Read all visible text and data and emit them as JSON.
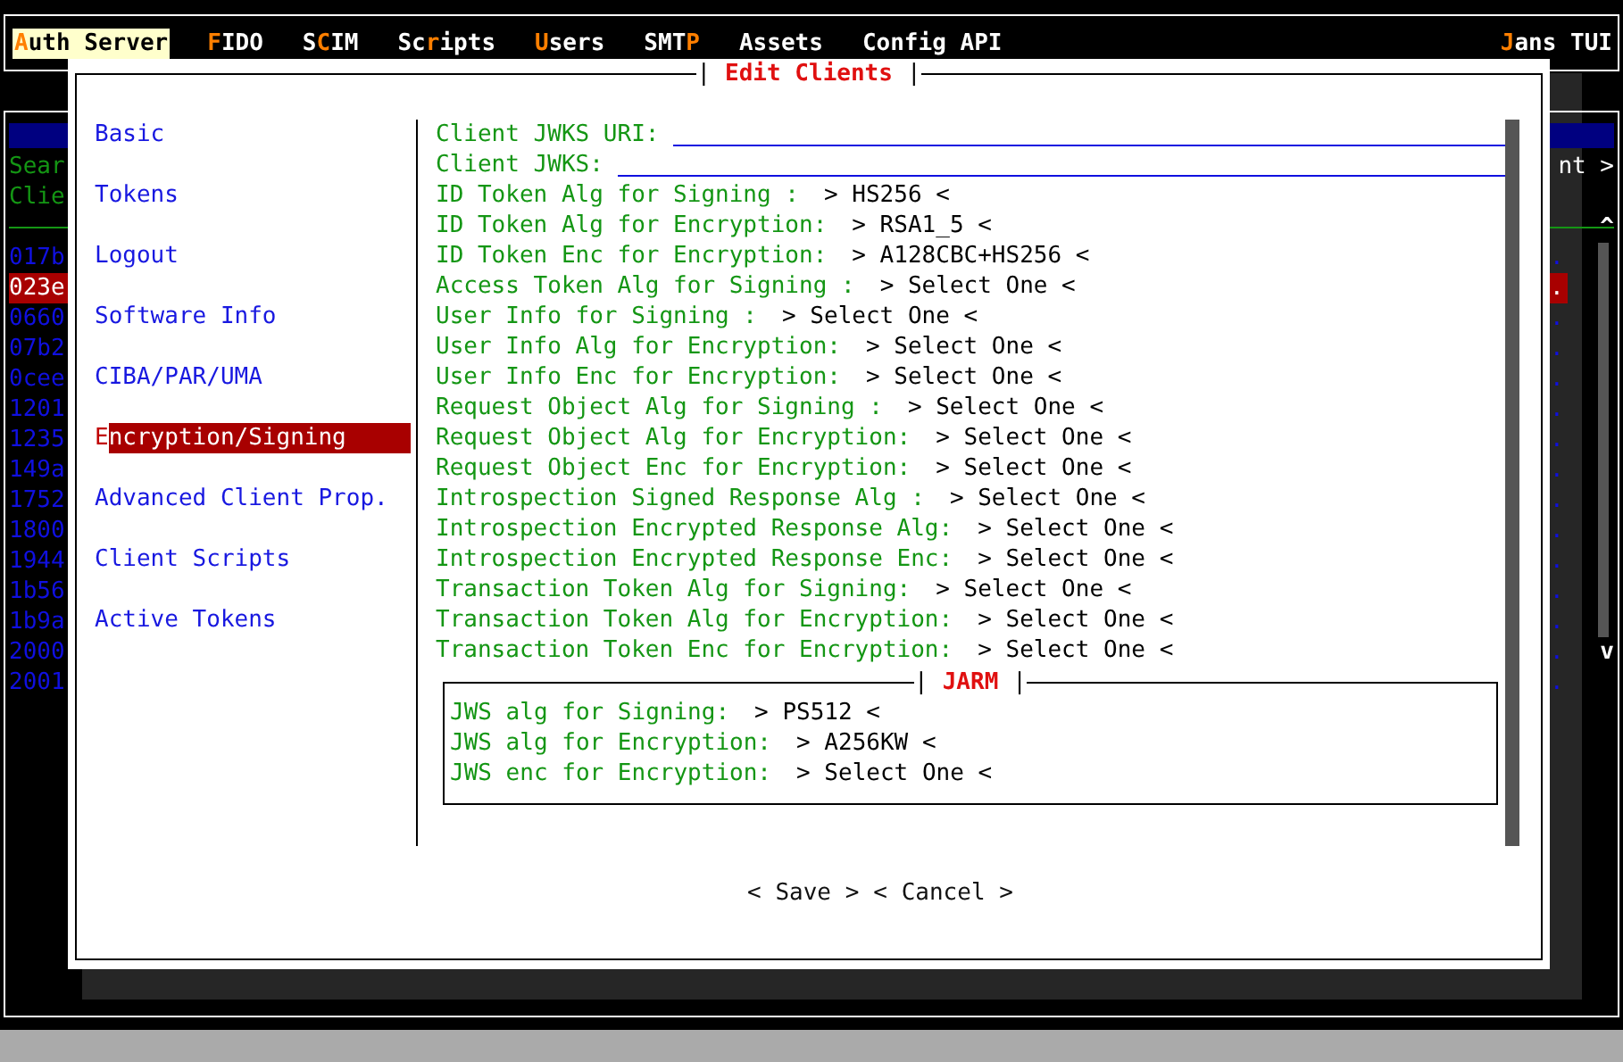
{
  "menu": [
    {
      "key": "A",
      "after": "uth Server",
      "selected": true
    },
    {
      "key": "F",
      "after": "IDO",
      "selected": false
    },
    {
      "before": "S",
      "key": "C",
      "after": "IM",
      "selected": false
    },
    {
      "before": "Sc",
      "key": "r",
      "after": "ipts",
      "selected": false
    },
    {
      "key": "U",
      "after": "sers",
      "selected": false
    },
    {
      "before": "SMT",
      "key": "P",
      "selected": false
    },
    {
      "before": "Assets",
      "selected": false
    },
    {
      "before": "Config API",
      "selected": false
    }
  ],
  "app_title": {
    "key": "J",
    "after": "ans TUI"
  },
  "background": {
    "search_label": "Sear",
    "list_label": "Clie",
    "right_label": "nt >",
    "scroll_up": "^",
    "scroll_down": "v",
    "rows": [
      {
        "id": "017b",
        "end": ".",
        "selected": false
      },
      {
        "id": "023e",
        "end": ".",
        "selected": true
      },
      {
        "id": "0660",
        "end": ".",
        "selected": false
      },
      {
        "id": "07b2",
        "end": ".",
        "selected": false
      },
      {
        "id": "0cee",
        "end": ".",
        "selected": false
      },
      {
        "id": "1201",
        "end": ".",
        "selected": false
      },
      {
        "id": "1235",
        "end": ".",
        "selected": false
      },
      {
        "id": "149a",
        "end": ".",
        "selected": false
      },
      {
        "id": "1752",
        "end": ".",
        "selected": false
      },
      {
        "id": "1800",
        "end": ".",
        "selected": false
      },
      {
        "id": "1944",
        "end": ".",
        "selected": false
      },
      {
        "id": "1b56",
        "end": ".",
        "selected": false
      },
      {
        "id": "1b9a",
        "end": ".",
        "selected": false
      },
      {
        "id": "2000",
        "end": ".",
        "selected": false
      },
      {
        "id": "2001",
        "end": ".",
        "selected": false
      }
    ]
  },
  "dialog": {
    "title": "Edit Clients",
    "title_frame": [
      "|",
      "|"
    ],
    "nav": [
      {
        "label": "Basic",
        "selected": false
      },
      {
        "label": "Tokens",
        "selected": false
      },
      {
        "label": "Logout",
        "selected": false
      },
      {
        "label": "Software Info",
        "selected": false
      },
      {
        "label": "CIBA/PAR/UMA",
        "selected": false
      },
      {
        "label": "Encryption/Signing",
        "selected": true
      },
      {
        "label": "Advanced Client Prop.",
        "selected": false
      },
      {
        "label": "Client Scripts",
        "selected": false
      },
      {
        "label": "Active Tokens",
        "selected": false
      }
    ],
    "fields": [
      {
        "kind": "text",
        "label": "Client JWKS URI:"
      },
      {
        "kind": "text",
        "label": "Client JWKS:"
      },
      {
        "kind": "select",
        "label": "ID Token Alg for Signing :",
        "value": "> HS256 <"
      },
      {
        "kind": "select",
        "label": "ID Token Alg for Encryption:",
        "value": "> RSA1_5 <"
      },
      {
        "kind": "select",
        "label": "ID Token Enc for Encryption:",
        "value": "> A128CBC+HS256 <"
      },
      {
        "kind": "select",
        "label": "Access Token Alg for Signing :",
        "value": "> Select One <"
      },
      {
        "kind": "select",
        "label": "User Info for Signing :",
        "value": "> Select One <"
      },
      {
        "kind": "select",
        "label": "User Info Alg for Encryption:",
        "value": "> Select One <"
      },
      {
        "kind": "select",
        "label": "User Info Enc for Encryption:",
        "value": "> Select One <"
      },
      {
        "kind": "select",
        "label": "Request Object Alg for Signing :",
        "value": "> Select One <"
      },
      {
        "kind": "select",
        "label": "Request Object Alg for Encryption:",
        "value": "> Select One <"
      },
      {
        "kind": "select",
        "label": "Request Object Enc for Encryption:",
        "value": "> Select One <"
      },
      {
        "kind": "select",
        "label": "Introspection Signed Response Alg :",
        "value": "> Select One <"
      },
      {
        "kind": "select",
        "label": "Introspection Encrypted Response Alg:",
        "value": "> Select One <"
      },
      {
        "kind": "select",
        "label": "Introspection Encrypted Response Enc:",
        "value": "> Select One <"
      },
      {
        "kind": "select",
        "label": "Transaction Token Alg for Signing:",
        "value": "> Select One <"
      },
      {
        "kind": "select",
        "label": "Transaction Token Alg for Encryption:",
        "value": "> Select One <"
      },
      {
        "kind": "select",
        "label": "Transaction Token Enc for Encryption:",
        "value": "> Select One <"
      }
    ],
    "jarm": {
      "title": "JARM",
      "title_frame": [
        "|",
        "|"
      ],
      "fields": [
        {
          "kind": "select",
          "label": "JWS alg for Signing:",
          "value": "> PS512 <"
        },
        {
          "kind": "select",
          "label": "JWS alg for Encryption:",
          "value": "> A256KW <"
        },
        {
          "kind": "select",
          "label": "JWS enc for Encryption:",
          "value": "> Select One <"
        }
      ]
    },
    "buttons": [
      "< Save >",
      "< Cancel >"
    ]
  }
}
